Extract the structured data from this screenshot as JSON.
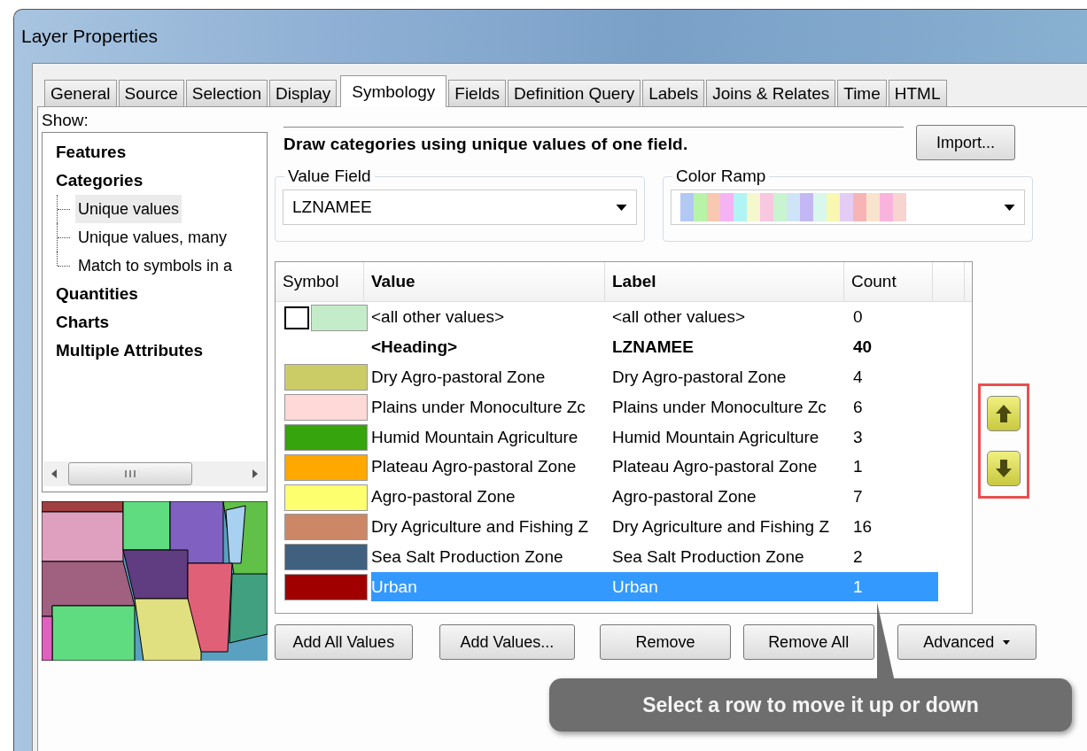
{
  "window": {
    "title": "Layer Properties"
  },
  "tabs": [
    {
      "label": "General",
      "selected": false
    },
    {
      "label": "Source",
      "selected": false
    },
    {
      "label": "Selection",
      "selected": false
    },
    {
      "label": "Display",
      "selected": false
    },
    {
      "label": "Symbology",
      "selected": true
    },
    {
      "label": "Fields",
      "selected": false
    },
    {
      "label": "Definition Query",
      "selected": false
    },
    {
      "label": "Labels",
      "selected": false
    },
    {
      "label": "Joins & Relates",
      "selected": false
    },
    {
      "label": "Time",
      "selected": false
    },
    {
      "label": "HTML",
      "selected": false
    }
  ],
  "show": {
    "label": "Show:",
    "items": [
      {
        "label": "Features",
        "selected": false
      },
      {
        "label": "Categories",
        "selected": false,
        "children": [
          {
            "label": "Unique values",
            "selected": true
          },
          {
            "label": "Unique values, many",
            "selected": false
          },
          {
            "label": "Match to symbols in a",
            "selected": false
          }
        ]
      },
      {
        "label": "Quantities",
        "selected": false
      },
      {
        "label": "Charts",
        "selected": false
      },
      {
        "label": "Multiple Attributes",
        "selected": false
      }
    ]
  },
  "description": "Draw categories using unique values of one field.",
  "import_button": "Import...",
  "value_field": {
    "label": "Value Field",
    "value": "LZNAMEE"
  },
  "color_ramp": {
    "label": "Color Ramp",
    "colors": [
      {
        "color": "#b4c8f4"
      },
      {
        "color": "#b8f4a8"
      },
      {
        "color": "#f8c8b0"
      },
      {
        "color": "#f4b4f4"
      },
      {
        "color": "#b0f4f4"
      },
      {
        "color": "#f4f8cc"
      },
      {
        "color": "#f8c8e0"
      },
      {
        "color": "#c8f4d0"
      },
      {
        "color": "#d0e4f8"
      },
      {
        "color": "#c4b8f4"
      },
      {
        "color": "#d8f8ec"
      },
      {
        "color": "#f8f8b0"
      },
      {
        "color": "#e4ccf4"
      },
      {
        "color": "#f8b4b4"
      },
      {
        "color": "#f8e4cc"
      },
      {
        "color": "#f8b4dc"
      },
      {
        "color": "#f8d4d0"
      }
    ]
  },
  "table": {
    "columns": [
      "Symbol",
      "Value",
      "Label",
      "Count"
    ],
    "rows": [
      {
        "kind": "default",
        "color": "#c4ecc8",
        "value": "<all other values>",
        "label": "<all other values>",
        "count": "0",
        "selected": false
      },
      {
        "kind": "heading",
        "value": "<Heading>",
        "label": "LZNAMEE",
        "count": "40",
        "selected": false
      },
      {
        "kind": "value",
        "color": "#cccc66",
        "value": "Dry Agro-pastoral Zone",
        "label": "Dry Agro-pastoral Zone",
        "count": "4",
        "selected": false
      },
      {
        "kind": "value",
        "color": "#ffd8d8",
        "value": "Plains under Monoculture Zc",
        "label": "Plains under Monoculture Zc",
        "count": "6",
        "selected": false
      },
      {
        "kind": "value",
        "color": "#36a40c",
        "value": "Humid Mountain Agriculture",
        "label": "Humid Mountain Agriculture",
        "count": "3",
        "selected": false
      },
      {
        "kind": "value",
        "color": "#ffa800",
        "value": "Plateau Agro-pastoral Zone",
        "label": "Plateau Agro-pastoral Zone",
        "count": "1",
        "selected": false
      },
      {
        "kind": "value",
        "color": "#ffff70",
        "value": "Agro-pastoral Zone",
        "label": "Agro-pastoral Zone",
        "count": "7",
        "selected": false
      },
      {
        "kind": "value",
        "color": "#cc8866",
        "value": "Dry Agriculture and Fishing Z",
        "label": "Dry Agriculture and Fishing Z",
        "count": "16",
        "selected": false
      },
      {
        "kind": "value",
        "color": "#406080",
        "value": "Sea Salt Production Zone",
        "label": "Sea Salt Production Zone",
        "count": "2",
        "selected": false
      },
      {
        "kind": "value",
        "color": "#a00000",
        "value": "Urban",
        "label": "Urban",
        "count": "1",
        "selected": true
      }
    ]
  },
  "buttons": [
    "Add All Values",
    "Add Values...",
    "Remove",
    "Remove All",
    "Advanced"
  ],
  "callout": "Select a row to move it up or down"
}
